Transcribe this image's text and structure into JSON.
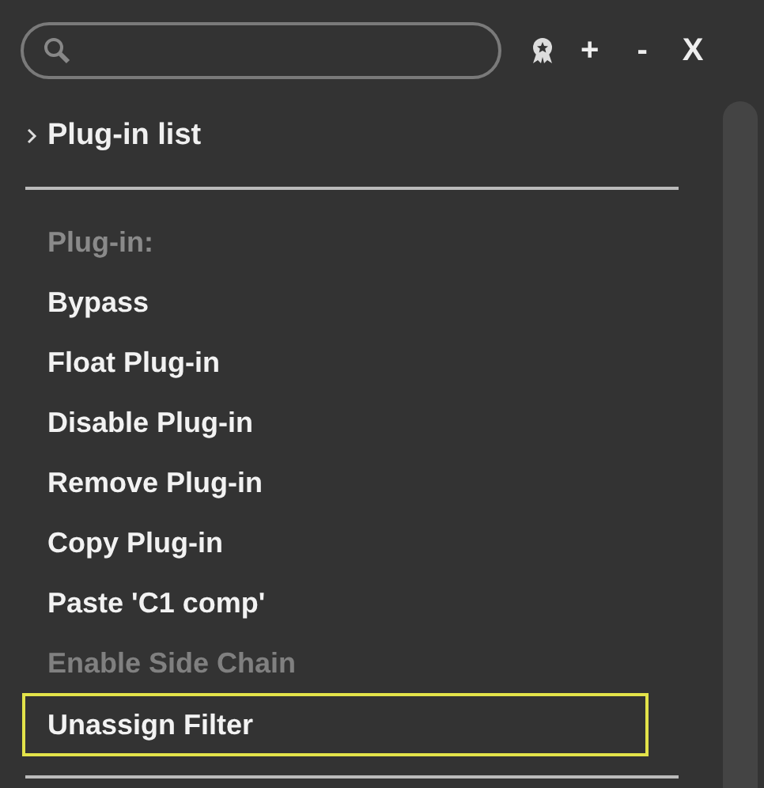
{
  "toolbar": {
    "buttons": [
      {
        "kind": "ribbon"
      },
      {
        "kind": "text",
        "label": "+"
      },
      {
        "kind": "text",
        "label": "-"
      },
      {
        "kind": "text",
        "label": "X"
      }
    ]
  },
  "plugin_list": {
    "label": "Plug-in list",
    "expanded": false
  },
  "menu": [
    {
      "kind": "header",
      "label": "Plug-in:"
    },
    {
      "kind": "item",
      "label": "Bypass",
      "disabled": false,
      "selected": false
    },
    {
      "kind": "item",
      "label": "Float Plug-in",
      "disabled": false,
      "selected": false
    },
    {
      "kind": "item",
      "label": "Disable Plug-in",
      "disabled": false,
      "selected": false
    },
    {
      "kind": "item",
      "label": "Remove Plug-in",
      "disabled": false,
      "selected": false
    },
    {
      "kind": "item",
      "label": "Copy Plug-in",
      "disabled": false,
      "selected": false
    },
    {
      "kind": "item",
      "label": "Paste 'C1 comp'",
      "disabled": false,
      "selected": false
    },
    {
      "kind": "item",
      "label": "Enable Side Chain",
      "disabled": true,
      "selected": false
    },
    {
      "kind": "item",
      "label": "Unassign Filter",
      "disabled": false,
      "selected": true
    }
  ]
}
